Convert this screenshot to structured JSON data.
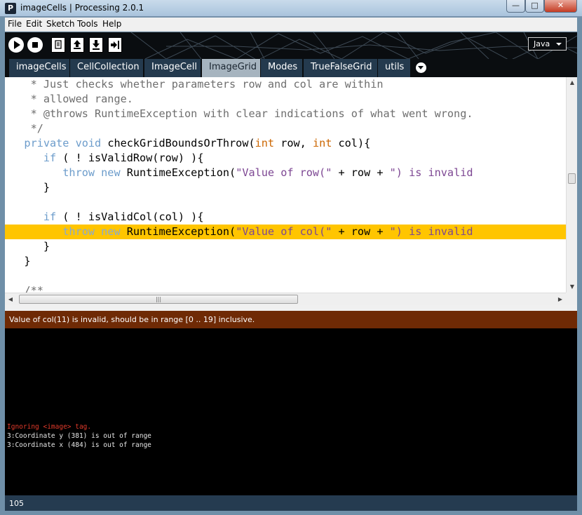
{
  "window": {
    "title": "imageCells | Processing 2.0.1",
    "app_icon": "P",
    "minimize": "—",
    "maximize": "□",
    "close": "✕"
  },
  "menu": [
    "File",
    "Edit",
    "Sketch",
    "Tools",
    "Help"
  ],
  "toolbar": {
    "buttons": [
      "run-icon",
      "stop-icon",
      "new-icon",
      "open-icon",
      "save-icon",
      "export-icon"
    ],
    "mode": "Java"
  },
  "tabs": [
    {
      "label": "imageCells",
      "active": false
    },
    {
      "label": "CellCollection",
      "active": false
    },
    {
      "label": "ImageCell",
      "active": false
    },
    {
      "label": "ImageGrid",
      "active": true
    },
    {
      "label": "Modes",
      "active": false
    },
    {
      "label": "TrueFalseGrid",
      "active": false
    },
    {
      "label": "utils",
      "active": false
    }
  ],
  "editor": {
    "lines": [
      {
        "highlight": false,
        "tokens": [
          {
            "t": "c",
            "s": "    * Just checks whether parameters row and col are within"
          }
        ]
      },
      {
        "highlight": false,
        "tokens": [
          {
            "t": "c",
            "s": "    * allowed range."
          }
        ]
      },
      {
        "highlight": false,
        "tokens": [
          {
            "t": "c",
            "s": "    * @throws RuntimeException with clear indications of what went wrong."
          }
        ]
      },
      {
        "highlight": false,
        "tokens": [
          {
            "t": "c",
            "s": "    */"
          }
        ]
      },
      {
        "highlight": false,
        "tokens": [
          {
            "t": "k",
            "s": "   private void "
          },
          {
            "t": "n",
            "s": "checkGridBoundsOrThrow("
          },
          {
            "t": "y",
            "s": "int"
          },
          {
            "t": "n",
            "s": " row, "
          },
          {
            "t": "y",
            "s": "int"
          },
          {
            "t": "n",
            "s": " col){"
          }
        ]
      },
      {
        "highlight": false,
        "tokens": [
          {
            "t": "k",
            "s": "      if"
          },
          {
            "t": "n",
            "s": " ( ! isValidRow(row) ){"
          }
        ]
      },
      {
        "highlight": false,
        "tokens": [
          {
            "t": "k",
            "s": "         throw new "
          },
          {
            "t": "n",
            "s": "RuntimeException("
          },
          {
            "t": "s",
            "s": "\"Value of row(\""
          },
          {
            "t": "n",
            "s": " + row + "
          },
          {
            "t": "s",
            "s": "\") is invalid"
          }
        ]
      },
      {
        "highlight": false,
        "tokens": [
          {
            "t": "n",
            "s": "      }"
          }
        ]
      },
      {
        "highlight": false,
        "tokens": [
          {
            "t": "n",
            "s": ""
          }
        ]
      },
      {
        "highlight": false,
        "tokens": [
          {
            "t": "k",
            "s": "      if"
          },
          {
            "t": "n",
            "s": " ( ! isValidCol(col) ){"
          }
        ]
      },
      {
        "highlight": true,
        "tokens": [
          {
            "t": "k",
            "s": "         throw new "
          },
          {
            "t": "n",
            "s": "RuntimeException("
          },
          {
            "t": "s",
            "s": "\"Value of col(\""
          },
          {
            "t": "n",
            "s": " + row + "
          },
          {
            "t": "s",
            "s": "\") is invalid"
          }
        ]
      },
      {
        "highlight": false,
        "tokens": [
          {
            "t": "n",
            "s": "      }"
          }
        ]
      },
      {
        "highlight": false,
        "tokens": [
          {
            "t": "n",
            "s": "   }"
          }
        ]
      },
      {
        "highlight": false,
        "tokens": [
          {
            "t": "n",
            "s": ""
          }
        ]
      },
      {
        "highlight": false,
        "tokens": [
          {
            "t": "c",
            "s": "   /**"
          }
        ]
      }
    ]
  },
  "status_message": "Value of col(11) is invalid, should be in range [0 .. 19] inclusive.",
  "console": [
    {
      "text": "Ignoring <image> tag.",
      "error": true
    },
    {
      "text": "3:Coordinate y (381) is out of range",
      "error": false
    },
    {
      "text": "3:Coordinate x (484) is out of range",
      "error": false
    }
  ],
  "footer": {
    "line_number": "105"
  },
  "colors": {
    "toolbar_bg": "#0a0d10",
    "tab_bg": "#243a4e",
    "tab_active_bg": "#a6b4bf",
    "highlight": "#ffc500",
    "status_bg": "#6f2a05",
    "footer_bg": "#253b50"
  }
}
